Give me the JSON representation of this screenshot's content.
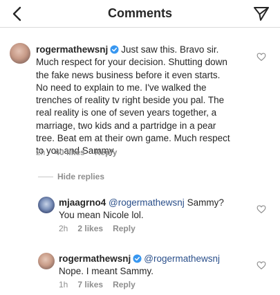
{
  "header": {
    "title": "Comments",
    "back_icon": "chevron-left-icon",
    "send_icon": "direct-send-icon"
  },
  "colors": {
    "text": "#262626",
    "muted": "#8e8e8e",
    "mention": "#2a4f8a",
    "verified": "#3897f0",
    "divider": "#dbdbdb"
  },
  "comment": {
    "username": "rogermathewsnj",
    "verified": true,
    "text_lines": [
      "Just saw this. Bravo sir.",
      "Much respect for your decision. Shutting down",
      "the fake news business before it even starts.",
      "No need to explain to me. I've walked the",
      "trenches of reality tv right beside you pal. The",
      "real reality is one of seven years together, a",
      "marriage, two kids and a partridge in a pear",
      "tree. Beat em at their own game. Much respect",
      "to you and Sammy."
    ],
    "time": "2h",
    "likes": "40 likes",
    "reply": "Reply"
  },
  "hide_replies": "Hide replies",
  "replies": [
    {
      "username": "mjaagrno4",
      "verified": false,
      "mention": "@rogermathewsnj",
      "text_first": "Sammy?",
      "text_second": "You mean Nicole lol.",
      "time": "2h",
      "likes": "2 likes",
      "reply": "Reply"
    },
    {
      "username": "rogermathewsnj",
      "verified": true,
      "mention": "@rogermathewsnj",
      "text_second": "Nope. I meant Sammy.",
      "time": "1h",
      "likes": "7 likes",
      "reply": "Reply"
    }
  ]
}
